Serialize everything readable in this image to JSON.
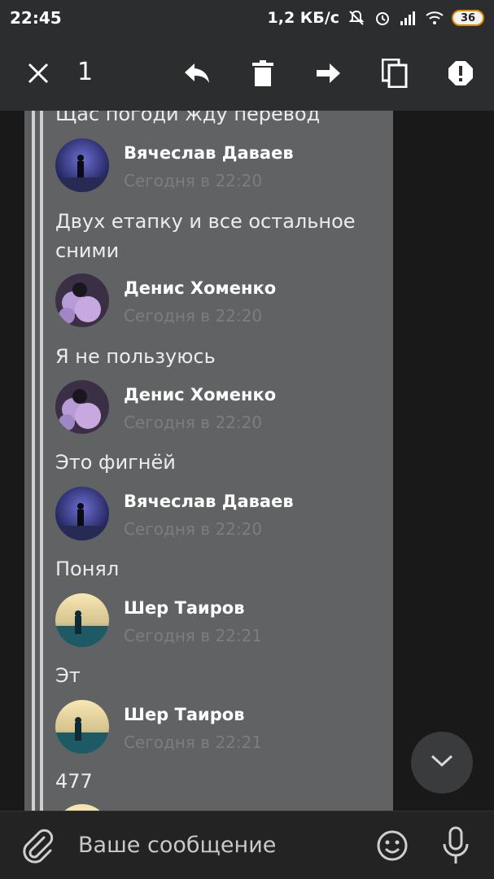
{
  "status_bar": {
    "time": "22:45",
    "network_speed": "1,2 КБ/с",
    "battery": "36",
    "icons": [
      "bell-off-icon",
      "alarm-icon",
      "signal-icon",
      "wifi-icon",
      "battery-icon"
    ]
  },
  "action_bar": {
    "selected_count": "1",
    "icons": [
      "close-icon",
      "reply-icon",
      "trash-icon",
      "forward-icon",
      "copy-icon",
      "report-icon"
    ]
  },
  "quoted_messages": {
    "top_partial_text": "Щас погоди жду перевод",
    "items": [
      {
        "sender": "Вячеслав Даваев",
        "time": "Сегодня в 22:20",
        "text": "Двух етапку и все остальное сними"
      },
      {
        "sender": "Денис Хоменко",
        "time": "Сегодня в 22:20",
        "text": "Я не пользуюсь"
      },
      {
        "sender": "Денис Хоменко",
        "time": "Сегодня в 22:20",
        "text": "Это фигнёй"
      },
      {
        "sender": "Вячеслав Даваев",
        "time": "Сегодня в 22:20",
        "text": "Понял"
      },
      {
        "sender": "Шер Таиров",
        "time": "Сегодня в 22:21",
        "text": "Эт"
      },
      {
        "sender": "Шер Таиров",
        "time": "Сегодня в 22:21",
        "text": "477"
      }
    ]
  },
  "composer": {
    "placeholder": "Ваше сообщение",
    "icons": [
      "attach-icon",
      "emoji-icon",
      "mic-icon"
    ]
  },
  "scroll_button": {
    "icon": "chevron-down-icon"
  }
}
